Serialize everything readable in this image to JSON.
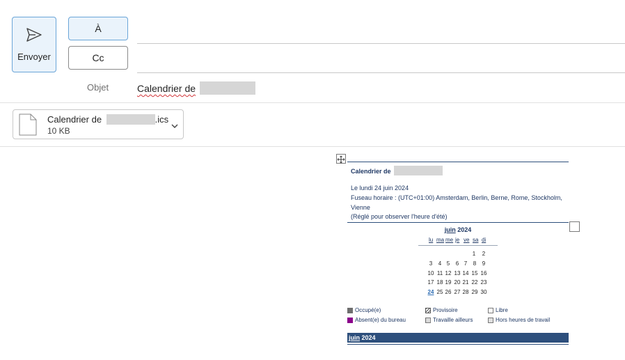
{
  "compose": {
    "send_label": "Envoyer",
    "to_label": "À",
    "cc_label": "Cc",
    "subject_label": "Objet",
    "subject_value": "Calendrier de"
  },
  "attachment": {
    "name_prefix": "Calendrier de",
    "extension": ".ics",
    "size": "10 KB"
  },
  "calendar": {
    "title": "Calendrier de",
    "date_line": "Le lundi 24 juin 2024",
    "tz_line1": "Fuseau horaire : (UTC+01:00) Amsterdam, Berlin, Berne, Rome, Stockholm,",
    "tz_line2": "Vienne",
    "dst_note": "(Réglé pour observer l'heure d'été)",
    "mini_month_name": "juin",
    "mini_month_year": "2024",
    "weekdays": [
      "lu",
      "ma",
      "me",
      "je",
      "ve",
      "sa",
      "di"
    ],
    "weeks": [
      [
        "",
        "",
        "",
        "",
        "",
        "1",
        "2"
      ],
      [
        "3",
        "4",
        "5",
        "6",
        "7",
        "8",
        "9"
      ],
      [
        "10",
        "11",
        "12",
        "13",
        "14",
        "15",
        "16"
      ],
      [
        "17",
        "18",
        "19",
        "20",
        "21",
        "22",
        "23"
      ],
      [
        "24",
        "25",
        "26",
        "27",
        "28",
        "29",
        "30"
      ]
    ],
    "today": "24",
    "legend": {
      "busy": "Occupé(e)",
      "tentative": "Provisoire",
      "free": "Libre",
      "oof": "Absent(e) du bureau",
      "elsewhere": "Travaille ailleurs",
      "off_hours": "Hors heures de travail"
    },
    "legend_colors": {
      "busy": "#6e6e6e",
      "oof": "#8b008b",
      "free": "#ffffff",
      "tentative": "#ffffff",
      "elsewhere": "#eeeeee",
      "off_hours": "#e0e0e0"
    },
    "month_bar_name": "juin",
    "month_bar_year": "2024"
  },
  "colors": {
    "accent": "#6aa5d8",
    "calendar_blue": "#2d4f7c"
  }
}
